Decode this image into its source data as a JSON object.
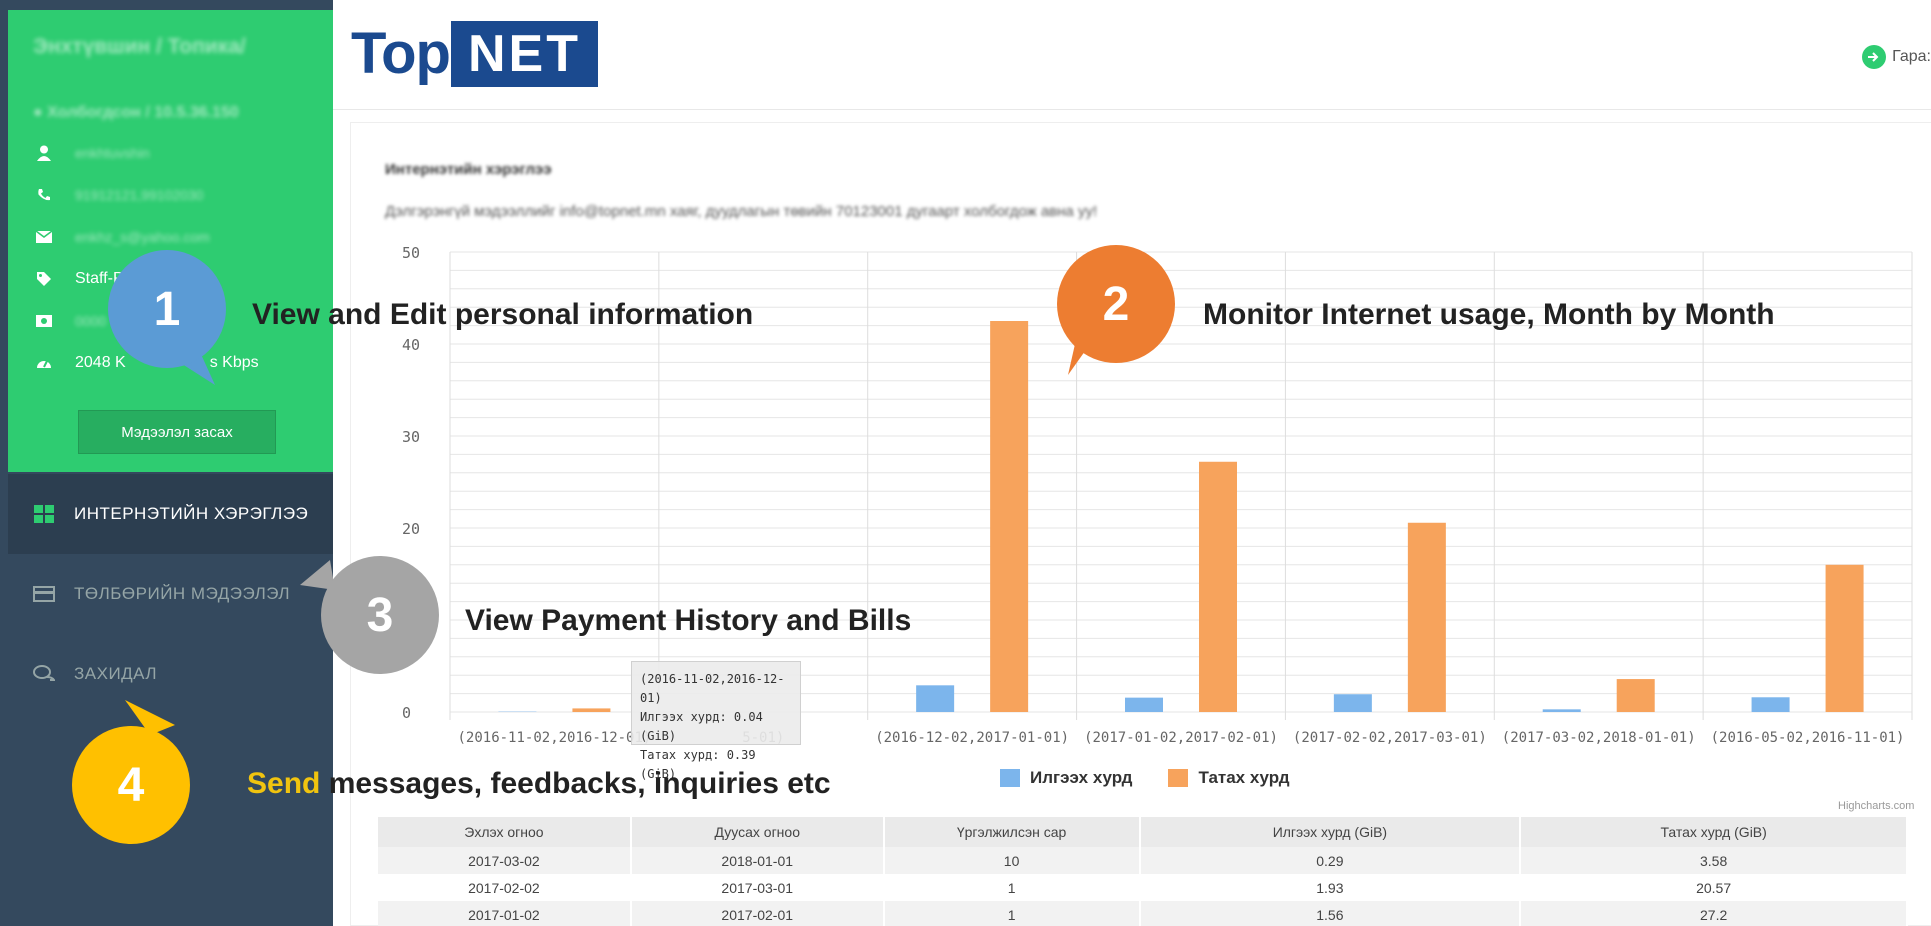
{
  "sidebar": {
    "profile": {
      "name": "Энхтүвшин / Топика/",
      "connection": "● Холбогдсон / 10.5.36.150",
      "rows": [
        {
          "icon": "user-icon",
          "text": "enkhtuvshin"
        },
        {
          "icon": "phone-icon",
          "text": "91912121,99102030"
        },
        {
          "icon": "envelope-icon",
          "text": "enkhz_s@yahoo.com"
        },
        {
          "icon": "tag-icon",
          "text": "Staff-P"
        },
        {
          "icon": "money-icon",
          "text": "0000"
        },
        {
          "icon": "speedometer-icon",
          "text": "2048 K",
          "suffix": "s Kbps"
        }
      ],
      "edit_button": "Мэдээлэл засах"
    },
    "nav": [
      {
        "icon": "grid-icon",
        "label": "ИНТЕРНЭТИЙН ХЭРЭГЛЭЭ"
      },
      {
        "icon": "credit-card-icon",
        "label": "ТӨЛБӨРИЙН МЭДЭЭЛЭЛ"
      },
      {
        "icon": "chat-icon",
        "label": "ЗАХИДАЛ"
      }
    ]
  },
  "header": {
    "logo_top": "Top",
    "logo_net": "NET",
    "logout": "Гара:"
  },
  "panel": {
    "title": "Интернэтийн хэрэглээ",
    "description": "Дэлгэрэнгүй мэдээллийг info@topnet.mn хаяг, дуудлагын төвийн 70123001 дугаарт холбогдож авна уу!"
  },
  "chart_data": {
    "type": "bar",
    "categories": [
      "(2016-11-02,2016-12-01)",
      "(2016-11-02,2016-12-01)",
      "(2016-12-02,2017-01-01)",
      "(2017-01-02,2017-02-01)",
      "(2017-02-02,2017-03-01)",
      "(2017-03-02,2018-01-01)",
      "(2016-05-02,2016-11-01)"
    ],
    "category_labels_visible": [
      "(2016-11-02,2016-12-01)",
      "5-01)",
      "(2016-12-02,2017-01-01)",
      "(2017-01-02,2017-02-01)",
      "(2017-02-02,2017-03-01)",
      "(2017-03-02,2018-01-01)",
      "(2016-05-02,2016-11-01)"
    ],
    "series": [
      {
        "name": "Илгээх хурд",
        "color": "#7cb5ec",
        "values": [
          0.04,
          0,
          2.9,
          1.56,
          1.93,
          0.29,
          1.6
        ]
      },
      {
        "name": "Татах хурд",
        "color": "#f7a35c",
        "values": [
          0.39,
          0,
          42.5,
          27.2,
          20.57,
          3.58,
          16.0
        ]
      }
    ],
    "yticks": [
      "50",
      "40",
      "30",
      "20",
      "0"
    ],
    "ylim": [
      0,
      50
    ],
    "grid": true,
    "legend": "bottom-center",
    "credits": "Highcharts.com",
    "tooltip": {
      "line1": "(2016-11-02,2016-12-01)",
      "line2": "Илгээх хурд: 0.04 (GiB)",
      "line3": "Татах хурд: 0.39 (GiB)"
    }
  },
  "table": {
    "headers": [
      "Эхлэх огноо",
      "Дуусах огноо",
      "Үргэлжилсэн сар",
      "Илгээх хурд (GiB)",
      "Татах хурд (GiB)"
    ],
    "rows": [
      [
        "2017-03-02",
        "2018-01-01",
        "10",
        "0.29",
        "3.58"
      ],
      [
        "2017-02-02",
        "2017-03-01",
        "1",
        "1.93",
        "20.57"
      ],
      [
        "2017-01-02",
        "2017-02-01",
        "1",
        "1.56",
        "27.2"
      ]
    ]
  },
  "annotations": [
    {
      "number": "1",
      "color": "#5b9bd5",
      "text": "View and Edit personal information"
    },
    {
      "number": "2",
      "color": "#ed7d31",
      "text": "Monitor Internet usage, Month by Month"
    },
    {
      "number": "3",
      "color": "#a5a5a5",
      "text": "View Payment History and Bills"
    },
    {
      "number": "4",
      "color": "#ffc000",
      "text_highlight": "Send",
      "text": " messages, feedbacks, inquiries etc"
    }
  ]
}
